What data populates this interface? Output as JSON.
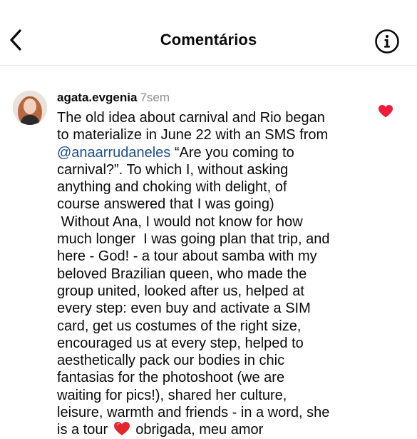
{
  "header": {
    "title": "Comentários",
    "back_icon": "chevron-left-icon",
    "info_icon": "info-circle-icon"
  },
  "comment": {
    "username": "agata.evgenia",
    "timestamp": "7sem",
    "liked": true,
    "like_color": "#ee1d3d",
    "para1_before_mention": "The old idea about carnival and Rio began\nto materialize in June 22 with an SMS from\n",
    "mention": "@anaarrudaneles",
    "mention_color": "#1d4f8a",
    "para1_after_mention": " “Are you coming to\ncarnival?”. To which I, without asking\nanything and choking with delight, of\ncourse answered that I was going)",
    "para2_before_heart": " Without Ana, I would not know for how\nmuch longer  I was going plan that trip, and\nhere - God! - a tour about samba with my\nbeloved Brazilian queen, who made the\ngroup united, looked after us, helped at\nevery step: even buy and activate a SIM\ncard, get us costumes of the right size,\nencouraged us at every step, helped to\naesthetically pack our bodies in chic\nfantasias for the photoshoot (we are\nwaiting for pics!), shared her culture,\nleisure, warmth and friends - in a word, she\nis a tour",
    "inline_emoji": "red-heart-emoji",
    "para2_after_heart": " obrigada, meu amor"
  }
}
